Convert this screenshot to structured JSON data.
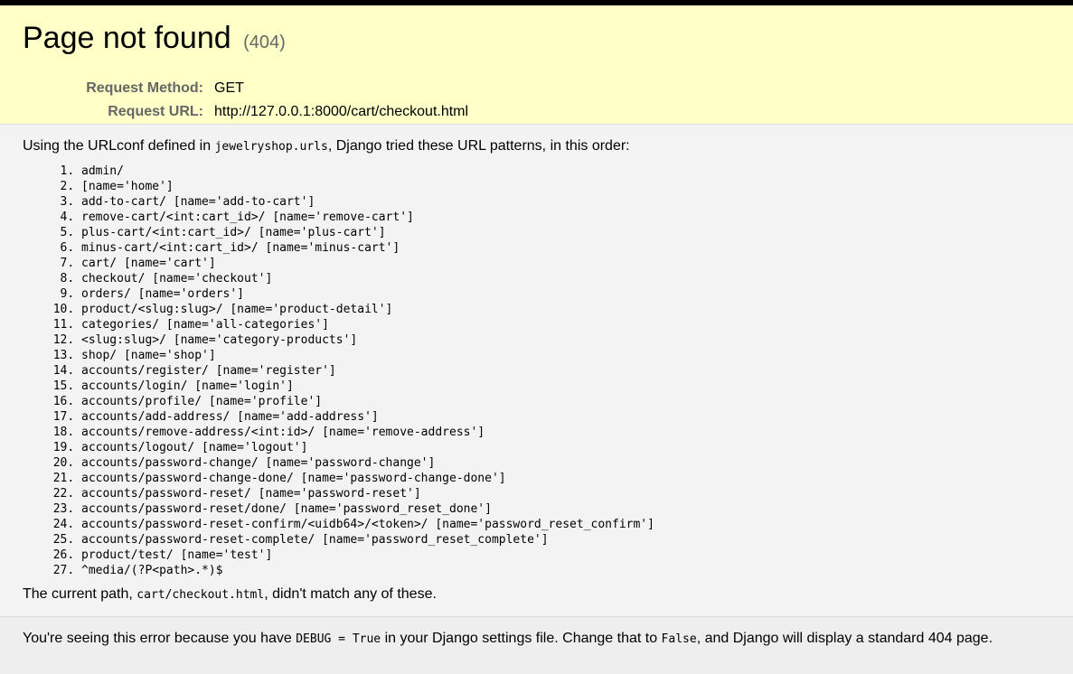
{
  "summary": {
    "title": "Page not found",
    "status_code": "(404)",
    "request_method_label": "Request Method:",
    "request_method": "GET",
    "request_url_label": "Request URL:",
    "request_url": "http://127.0.0.1:8000/cart/checkout.html"
  },
  "info": {
    "intro_prefix": "Using the URLconf defined in ",
    "urlconf": "jewelryshop.urls",
    "intro_suffix": ", Django tried these URL patterns, in this order:",
    "patterns": [
      "admin/",
      "[name='home']",
      "add-to-cart/ [name='add-to-cart']",
      "remove-cart/<int:cart_id>/ [name='remove-cart']",
      "plus-cart/<int:cart_id>/ [name='plus-cart']",
      "minus-cart/<int:cart_id>/ [name='minus-cart']",
      "cart/ [name='cart']",
      "checkout/ [name='checkout']",
      "orders/ [name='orders']",
      "product/<slug:slug>/ [name='product-detail']",
      "categories/ [name='all-categories']",
      "<slug:slug>/ [name='category-products']",
      "shop/ [name='shop']",
      "accounts/register/ [name='register']",
      "accounts/login/ [name='login']",
      "accounts/profile/ [name='profile']",
      "accounts/add-address/ [name='add-address']",
      "accounts/remove-address/<int:id>/ [name='remove-address']",
      "accounts/logout/ [name='logout']",
      "accounts/password-change/ [name='password-change']",
      "accounts/password-change-done/ [name='password-change-done']",
      "accounts/password-reset/ [name='password-reset']",
      "accounts/password-reset/done/ [name='password_reset_done']",
      "accounts/password-reset-confirm/<uidb64>/<token>/ [name='password_reset_confirm']",
      "accounts/password-reset-complete/ [name='password_reset_complete']",
      "product/test/ [name='test']",
      "^media/(?P<path>.*)$"
    ],
    "current_path_prefix": "The current path, ",
    "current_path": "cart/checkout.html",
    "current_path_suffix": ", didn't match any of these."
  },
  "explanation": {
    "prefix": "You're seeing this error because you have ",
    "debug_code": "DEBUG = True",
    "middle": " in your Django settings file. Change that to ",
    "false_code": "False",
    "suffix": ", and Django will display a standard 404 page."
  }
}
